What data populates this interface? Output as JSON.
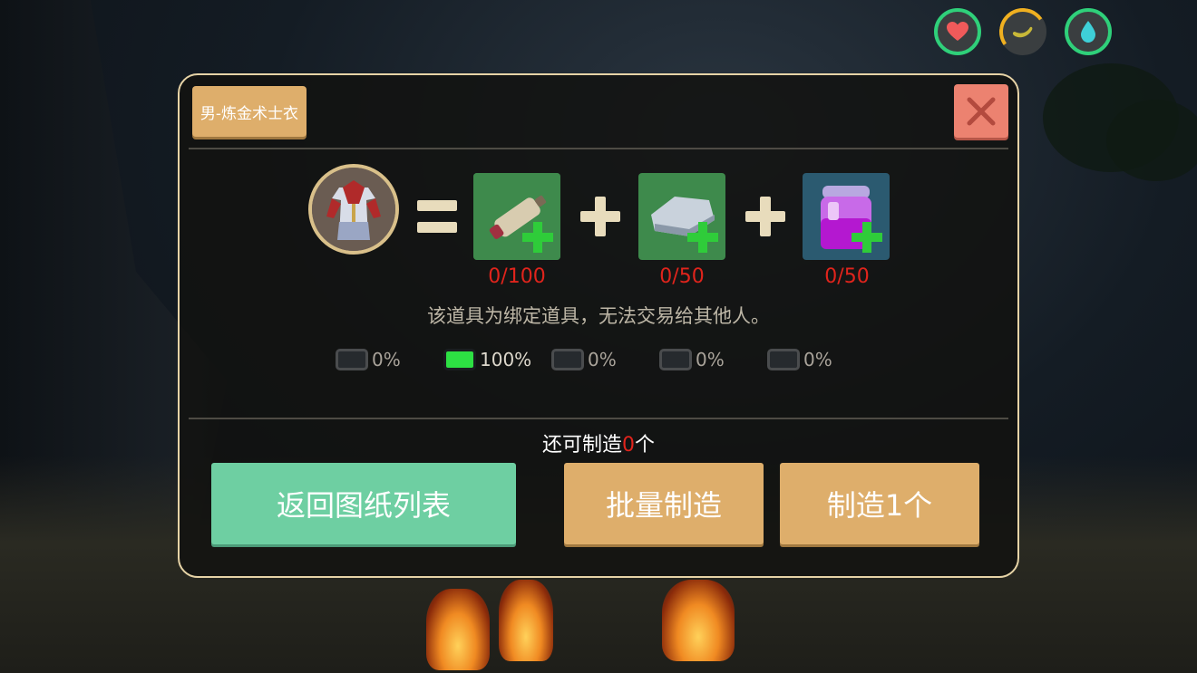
{
  "hud": {
    "health_icon": "heart-icon",
    "hunger_icon": "banana-icon",
    "water_icon": "water-drop-icon"
  },
  "panel": {
    "title": "男-炼金术士衣",
    "close_icon": "close-icon",
    "recipe": {
      "result_icon": "alchemist-robe-icon",
      "materials": [
        {
          "icon": "thread-spool-icon",
          "count": "0/100"
        },
        {
          "icon": "cloth-icon",
          "count": "0/50"
        },
        {
          "icon": "purple-potion-jar-icon",
          "count": "0/50"
        }
      ]
    },
    "notice": "该道具为绑定道具，无法交易给其他人。",
    "chances": [
      {
        "label": "0%",
        "selected": false
      },
      {
        "label": "100%",
        "selected": true
      },
      {
        "label": "0%",
        "selected": false
      },
      {
        "label": "0%",
        "selected": false
      },
      {
        "label": "0%",
        "selected": false
      }
    ],
    "remain": {
      "prefix": "还可制造",
      "count": "0",
      "suffix": "个"
    },
    "buttons": {
      "back": "返回图纸列表",
      "batch": "批量制造",
      "make_one": "制造1个"
    }
  },
  "colors": {
    "accent_green": "#6ecfa2",
    "accent_orange": "#deae6b",
    "close_red": "#ec8270",
    "count_red": "#e0241c"
  }
}
